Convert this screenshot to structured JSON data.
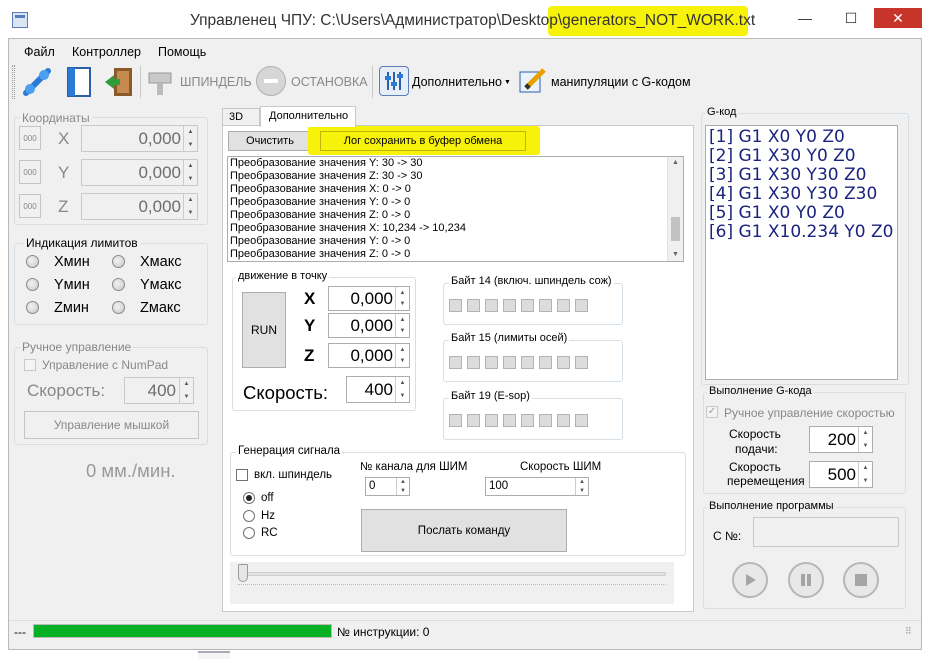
{
  "window": {
    "title": "Управленец ЧПУ: C:\\Users\\Администратор\\Desktop\\generators_NOT_WORK.txt",
    "controls": {
      "minimize": "—",
      "maximize": "☐",
      "close": "✕"
    }
  },
  "menu": {
    "items": [
      "Файл",
      "Контроллер",
      "Помощь"
    ]
  },
  "toolbar": {
    "spindle_label": "ШПИНДЕЛЬ",
    "stop_label": "ОСТАНОВКА",
    "extra_label": "Дополнительно",
    "gcode_label": "манипуляции с G-кодом"
  },
  "coords": {
    "title": "Координаты",
    "axes": [
      {
        "btn": "000",
        "axis": "X",
        "value": "0,000"
      },
      {
        "btn": "000",
        "axis": "Y",
        "value": "0,000"
      },
      {
        "btn": "000",
        "axis": "Z",
        "value": "0,000"
      }
    ]
  },
  "limits": {
    "title": "Индикация лимитов",
    "items": [
      "Xмин",
      "Xмакс",
      "Yмин",
      "Yмакс",
      "Zмин",
      "Zмакс"
    ]
  },
  "manual": {
    "title": "Ручное управление",
    "numpad_label": "Управление с NumPad",
    "speed_label": "Скорость:",
    "speed_value": "400",
    "mouse_btn": "Управление мышкой",
    "speed_readout": "0 мм./мин."
  },
  "tabs": {
    "items": [
      "3D",
      "Дополнительно"
    ],
    "active": "Дополнительно"
  },
  "log": {
    "clear_btn": "Очистить",
    "copy_btn": "Лог сохранить в буфер обмена",
    "lines": [
      "Преобразование значения Y: 30 -> 30",
      "Преобразование значения Z: 30 -> 30",
      "Преобразование значения X: 0 -> 0",
      "Преобразование значения Y: 0 -> 0",
      "Преобразование значения Z: 0 -> 0",
      "Преобразование значения X: 10,234 -> 10,234",
      "Преобразование значения Y: 0 -> 0",
      "Преобразование значения Z: 0 -> 0"
    ]
  },
  "move": {
    "title": "движение в точку",
    "run": "RUN",
    "x_label": "X",
    "x_value": "0,000",
    "y_label": "Y",
    "y_value": "0,000",
    "z_label": "Z",
    "z_value": "0,000",
    "speed_label": "Скорость:",
    "speed_value": "400"
  },
  "bytes": [
    {
      "title": "Байт 14 (включ. шпиндель сож)"
    },
    {
      "title": "Байт 15 (лимиты осей)"
    },
    {
      "title": "Байт 19 (E-sop)"
    }
  ],
  "signal": {
    "title": "Генерация сигнала",
    "spindle_check": "вкл. шпиндель",
    "modes": [
      "off",
      "Hz",
      "RC"
    ],
    "selected_mode": "off",
    "channel_label": "№ канала для ШИМ",
    "channel_value": "0",
    "pwm_speed_label": "Скорость ШИМ",
    "pwm_speed_value": "100",
    "send_btn": "Послать команду",
    "slider_level": 0
  },
  "gcode": {
    "title": "G-код",
    "lines": [
      "[1] G1 X0 Y0 Z0",
      "[2] G1 X30 Y0 Z0",
      "[3] G1 X30 Y30 Z0",
      "[4] G1 X30 Y30 Z30",
      "[5] G1 X0 Y0 Z0",
      "[6] G1 X10.234 Y0 Z0"
    ]
  },
  "gexec": {
    "title": "Выполнение G-кода",
    "manual_speed": "Ручное управление скоростью",
    "feed_label_1": "Скорость",
    "feed_label_2": "подачи:",
    "feed_value": "200",
    "move_label_1": "Скорость",
    "move_label_2": "перемещения",
    "move_value": "500"
  },
  "program": {
    "title": "Выполнение программы",
    "c_label": "С №:"
  },
  "status": {
    "left": "---",
    "progress": 1.0,
    "instruction": "№ инструкции: 0"
  },
  "colors": {
    "highlight": "#f6f20a",
    "progress": "#06b025",
    "gcode_text": "#1a237e"
  }
}
